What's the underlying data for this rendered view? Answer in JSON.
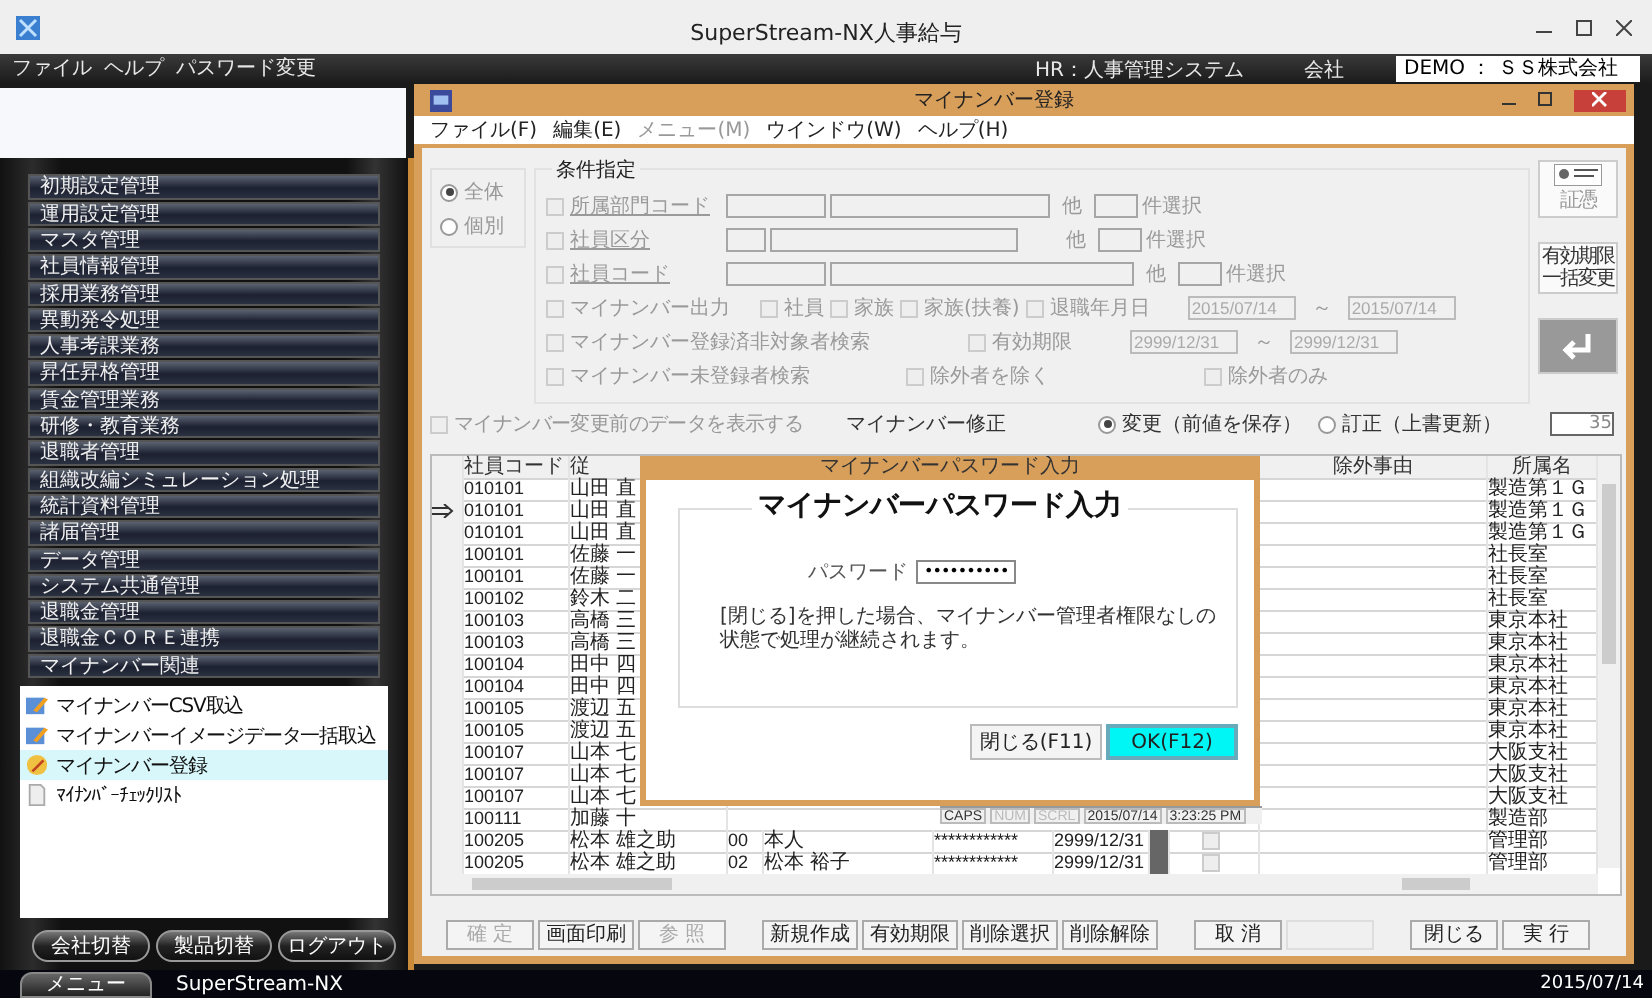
{
  "app": {
    "title": "SuperStream-NX人事給与",
    "menu": [
      "ファイル",
      "ヘルプ",
      "パスワード変更"
    ],
    "system": "HR：人事管理システム",
    "company_label": "会社",
    "company": "DEMO ： ＳＳ株式会社"
  },
  "sidebar": {
    "items": [
      {
        "label": "初期設定管理"
      },
      {
        "label": "運用設定管理"
      },
      {
        "label": "マスタ管理"
      },
      {
        "label": "社員情報管理"
      },
      {
        "label": "採用業務管理"
      },
      {
        "label": "異動発令処理"
      },
      {
        "label": "人事考課業務"
      },
      {
        "label": "昇任昇格管理"
      },
      {
        "label": "賃金管理業務"
      },
      {
        "label": "研修・教育業務"
      },
      {
        "label": "退職者管理"
      },
      {
        "label": "組織改編シミュレーション処理"
      },
      {
        "label": "統計資料管理"
      },
      {
        "label": "諸届管理"
      },
      {
        "label": "データ管理"
      },
      {
        "label": "システム共通管理"
      },
      {
        "label": "退職金管理"
      },
      {
        "label": "退職金ＣＯＲＥ連携"
      },
      {
        "label": "マイナンバー関連"
      }
    ],
    "subitems": [
      {
        "label": "マイナンバーCSV取込",
        "kind": "pencil",
        "selected": false
      },
      {
        "label": "マイナンバーイメージデータ一括取込",
        "kind": "pencil",
        "selected": false
      },
      {
        "label": "マイナンバー登録",
        "kind": "edit",
        "selected": true
      },
      {
        "label": "ﾏｲﾅﾝﾊﾞｰﾁｪｯｸﾘｽﾄ",
        "kind": "document",
        "selected": false
      }
    ],
    "buttons": [
      "会社切替",
      "製品切替",
      "ログアウト"
    ]
  },
  "window": {
    "title": "マイナンバー登録",
    "menu": [
      {
        "label": "ファイル(F)",
        "disabled": false
      },
      {
        "label": "編集(E)",
        "disabled": false
      },
      {
        "label": "メニュー(M)",
        "disabled": true
      },
      {
        "label": "ウインドウ(W)",
        "disabled": false
      },
      {
        "label": "ヘルプ(H)",
        "disabled": false
      }
    ]
  },
  "conditions": {
    "title": "条件指定",
    "disabled": true,
    "scope": [
      {
        "label": "全体",
        "selected": true
      },
      {
        "label": "個別",
        "selected": false
      }
    ],
    "code_filters": [
      {
        "label": "所属部門コード",
        "checked": false,
        "other": "他",
        "count_label": "件選択"
      },
      {
        "label": "社員区分",
        "checked": false,
        "other": "他",
        "count_label": "件選択"
      },
      {
        "label": "社員コード",
        "checked": false,
        "other": "他",
        "count_label": "件選択"
      }
    ],
    "output": {
      "label": "マイナンバー出力",
      "checked": false
    },
    "targets": [
      {
        "label": "社員",
        "checked": false
      },
      {
        "label": "家族",
        "checked": false
      },
      {
        "label": "家族(扶養)",
        "checked": false
      }
    ],
    "retire_date": {
      "label": "退職年月日",
      "checked": false,
      "from": "2015/07/14",
      "separator": "～",
      "to": "2015/07/14"
    },
    "registered_search": {
      "label": "マイナンバー登録済非対象者検索",
      "checked": false
    },
    "expiry": {
      "label": "有効期限",
      "checked": false,
      "from": "2999/12/31",
      "separator": "～",
      "to": "2999/12/31"
    },
    "unregistered_search": {
      "label": "マイナンバー未登録者検索",
      "checked": false
    },
    "exclude": [
      {
        "label": "除外者を除く",
        "checked": false
      },
      {
        "label": "除外者のみ",
        "checked": false
      }
    ]
  },
  "side_buttons": [
    {
      "kind": "image",
      "lines": [
        "証憑"
      ]
    },
    {
      "kind": "text",
      "lines": [
        "有効期限",
        "一括変更"
      ]
    },
    {
      "kind": "enter"
    }
  ],
  "edit_bar": {
    "show_previous": {
      "label": "マイナンバー変更前のデータを表示する",
      "checked": false
    },
    "mode_label": "マイナンバー修正",
    "modes": [
      {
        "label": "変更（前値を保存）",
        "selected": true
      },
      {
        "label": "訂正（上書更新）",
        "selected": false
      }
    ],
    "count": "35"
  },
  "table": {
    "columns": [
      "社員コード",
      "従",
      "除外事由",
      "所属名"
    ],
    "rows": [
      {
        "code": "010101",
        "name": "山田 直",
        "dept": "製造第１Ｇ",
        "current": false
      },
      {
        "code": "010101",
        "name": "山田 直",
        "dept": "製造第１Ｇ",
        "current": true
      },
      {
        "code": "010101",
        "name": "山田 直",
        "dept": "製造第１Ｇ",
        "current": false
      },
      {
        "code": "100101",
        "name": "佐藤 一",
        "dept": "社長室",
        "current": false
      },
      {
        "code": "100101",
        "name": "佐藤 一",
        "dept": "社長室",
        "current": false
      },
      {
        "code": "100102",
        "name": "鈴木 二",
        "dept": "社長室",
        "current": false
      },
      {
        "code": "100103",
        "name": "高橋 三",
        "dept": "東京本社",
        "current": false
      },
      {
        "code": "100103",
        "name": "高橋 三",
        "dept": "東京本社",
        "current": false
      },
      {
        "code": "100104",
        "name": "田中 四",
        "dept": "東京本社",
        "current": false
      },
      {
        "code": "100104",
        "name": "田中 四",
        "dept": "東京本社",
        "current": false
      },
      {
        "code": "100105",
        "name": "渡辺 五",
        "dept": "東京本社",
        "current": false
      },
      {
        "code": "100105",
        "name": "渡辺 五",
        "dept": "東京本社",
        "current": false
      },
      {
        "code": "100107",
        "name": "山本 七",
        "dept": "大阪支社",
        "current": false
      },
      {
        "code": "100107",
        "name": "山本 七",
        "dept": "大阪支社",
        "current": false
      },
      {
        "code": "100107",
        "name": "山本 七",
        "dept": "大阪支社",
        "current": false
      },
      {
        "code": "100111",
        "name": "加藤 十",
        "dept": "製造部",
        "current": false
      },
      {
        "code": "100205",
        "name": "松本 雄之助",
        "relation_code": "00",
        "relation": "本人",
        "number": "************",
        "expiry": "2999/12/31",
        "checked": false,
        "dept": "管理部",
        "current": false
      },
      {
        "code": "100205",
        "name": "松本 雄之助",
        "relation_code": "02",
        "relation": "松本 裕子",
        "number": "************",
        "expiry": "2999/12/31",
        "checked": false,
        "dept": "管理部",
        "current": false
      }
    ]
  },
  "status_strip": [
    {
      "text": "CAPS",
      "on": true
    },
    {
      "text": "NUM",
      "on": false
    },
    {
      "text": "SCRL",
      "on": false
    },
    {
      "text": "2015/07/14",
      "on": true
    },
    {
      "text": "3:23:25 PM",
      "on": true
    }
  ],
  "dialog": {
    "title": "マイナンバーパスワード入力",
    "heading": "マイナンバーパスワード入力",
    "password_label": "パスワード",
    "password": "••••••••••",
    "message": "[閉じる]を押した場合、マイナンバー管理者権限なしの状態で処理が継続されます。",
    "buttons": [
      {
        "label": "閉じる(F11)",
        "focused": false
      },
      {
        "label": "OK(F12)",
        "focused": true
      }
    ]
  },
  "footer_buttons": [
    {
      "label": "確 定",
      "disabled": true
    },
    {
      "label": "画面印刷",
      "disabled": false
    },
    {
      "label": "参 照",
      "disabled": true
    },
    {
      "label": "新規作成",
      "disabled": false
    },
    {
      "label": "有効期限",
      "disabled": false
    },
    {
      "label": "削除選択",
      "disabled": false
    },
    {
      "label": "削除解除",
      "disabled": false
    },
    {
      "label": "取 消",
      "disabled": false
    },
    {
      "label": "閉じる",
      "disabled": false
    },
    {
      "label": "実 行",
      "disabled": false
    }
  ],
  "taskbar": {
    "menu_button": "メニュー",
    "app": "SuperStream-NX",
    "date": "2015/07/14"
  }
}
